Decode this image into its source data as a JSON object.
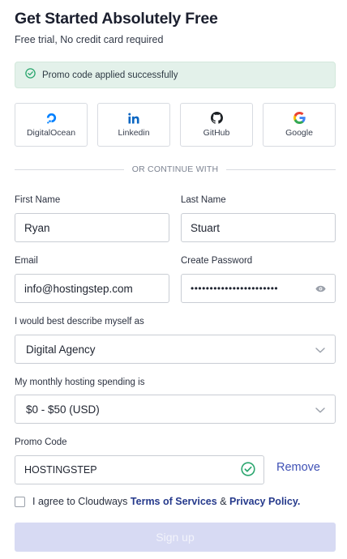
{
  "header": {
    "title": "Get Started Absolutely Free",
    "subtitle": "Free trial, No credit card required"
  },
  "promo_alert": {
    "text": "Promo code applied successfully",
    "icon": "check-circle-icon",
    "color": "#2aa66e"
  },
  "oauth": [
    {
      "label": "DigitalOcean",
      "icon": "digitalocean-icon",
      "color": "#0080ff"
    },
    {
      "label": "Linkedin",
      "icon": "linkedin-icon",
      "color": "#0a66c2"
    },
    {
      "label": "GitHub",
      "icon": "github-icon",
      "color": "#1b1f23"
    },
    {
      "label": "Google",
      "icon": "google-icon",
      "color": "#4285f4"
    }
  ],
  "divider_text": "OR CONTINUE WITH",
  "form": {
    "first_name": {
      "label": "First Name",
      "value": "Ryan"
    },
    "last_name": {
      "label": "Last Name",
      "value": "Stuart"
    },
    "email": {
      "label": "Email",
      "value": "info@hostingstep.com"
    },
    "password": {
      "label": "Create Password",
      "value": "•••••••••••••••••••••••"
    },
    "describe": {
      "label": "I would best describe myself as",
      "value": "Digital Agency"
    },
    "spending": {
      "label": "My monthly hosting spending is",
      "value": "$0 - $50 (USD)"
    },
    "promo": {
      "label": "Promo Code",
      "value": "HOSTINGSTEP",
      "remove_label": "Remove"
    }
  },
  "agree": {
    "prefix": "I agree to Cloudways",
    "terms": "Terms of Services",
    "amp": "&",
    "privacy": "Privacy Policy."
  },
  "signup_label": "Sign up",
  "colors": {
    "accent": "#3f51b5",
    "success": "#2aa66e",
    "disabled_button": "#d7daf3"
  }
}
